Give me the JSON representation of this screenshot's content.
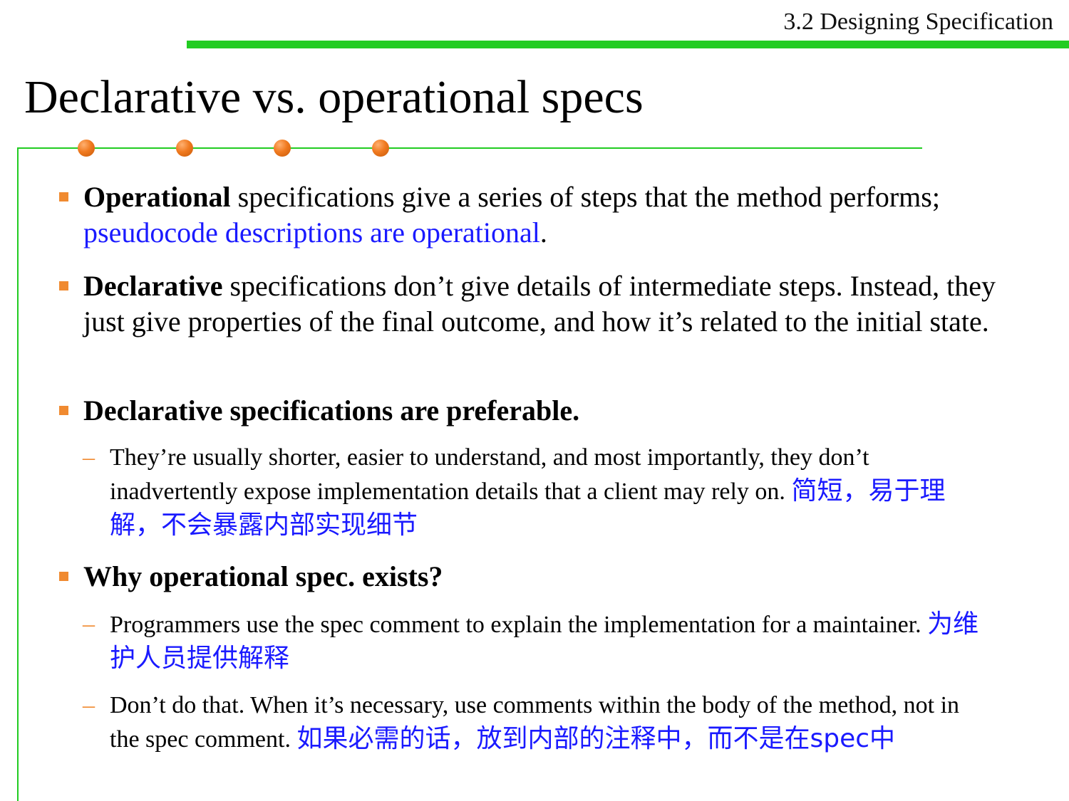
{
  "header": {
    "section": "3.2 Designing Specification"
  },
  "title": "Declarative vs. operational specs",
  "bullets": [
    {
      "bold": "Operational",
      "text": " specifications give a series of steps that the method performs; ",
      "blue": "pseudocode descriptions are operational",
      "tail": "."
    },
    {
      "bold": "Declarative",
      "text": " specifications don’t give details of intermediate steps. Instead, they just give properties of the final outcome, and how it’s related to the initial state."
    },
    {
      "bold": "Declarative specifications are preferable.",
      "subs": [
        {
          "text": "They’re usually shorter, easier to understand, and most importantly, they don’t inadvertently expose implementation details that a client may rely on. ",
          "cn": "简短，易于理解，不会暴露内部实现细节"
        }
      ]
    },
    {
      "bold": "Why operational spec. exists?",
      "subs": [
        {
          "text": "Programmers use the spec comment to explain the implementation for a maintainer.  ",
          "cn": "为维护人员提供解释"
        },
        {
          "text": "Don’t do that. When it’s necessary, use comments within the body of the method, not in the spec comment. ",
          "cn": "如果必需的话，放到内部的注释中，而不是在spec中"
        }
      ]
    }
  ],
  "colors": {
    "accent_green": "#22cc22",
    "accent_orange": "#f08a30",
    "highlight_blue": "#1a1aff"
  }
}
